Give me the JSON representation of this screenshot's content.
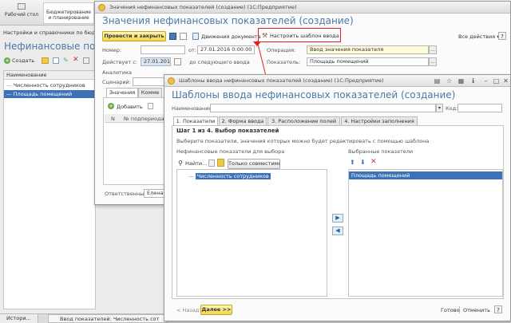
{
  "colors": {
    "accent": "#4a7aa6",
    "highlight_red": "#e02020",
    "selection": "#3e72b8"
  },
  "sections": [
    {
      "label": "Рабочий стол",
      "icon": "desktop-icon"
    },
    {
      "label": "Бюджетирование и планирование",
      "icon": "budget-icon"
    }
  ],
  "nav": {
    "breadcrumb": "Настройки и справочники по бюджет"
  },
  "list_form": {
    "title": "Нефинансовые показа",
    "create_button": "Создать",
    "column_header": "Наименование",
    "items": [
      "Численность сотрудников",
      "Площадь помещений"
    ]
  },
  "statusbar": {
    "tabs": [
      "Истори...",
      "Ввод показателей: Численность сот"
    ]
  },
  "doc_window": {
    "window_title": "Значения нефинансовых показателей (создание)  (1С:Предприятие)",
    "form_title": "Значения нефинансовых показателей (создание)",
    "post_close_button": "Провести и закрыть",
    "movements_button": "Движения документа",
    "setup_template_button": "Настроить шаблон ввода",
    "all_actions": "Все действия ▾",
    "help": "?",
    "number_label": "Номер:",
    "from_label": "от:",
    "date_value": "27.01.2016  0:00:00",
    "operation_label": "Операция:",
    "operation_value": "Ввод значения показателя",
    "effective_label": "Действует с:",
    "effective_value": "27.01.2016",
    "until_label": "до следующего ввода",
    "indicator_label": "Показатель:",
    "indicator_value": "Площадь помещений",
    "analytics_label": "Аналитика",
    "scenario_label": "Сценарий:",
    "tabs": [
      "Значения",
      "Комме"
    ],
    "add_button": "Добавить",
    "table_headers": [
      "N",
      "№ подпериода"
    ],
    "responsible_label": "Ответственный:",
    "responsible_value": "Елена"
  },
  "wizard": {
    "window_title": "Шаблоны ввода нефинансовых показателей (создание)  (1С:Предприятие)",
    "form_title": "Шаблоны ввода нефинансовых показателей (создание)",
    "name_label": "Наименование:",
    "code_label": "Код:",
    "tabs": [
      "1. Показатели",
      "2. Форма ввода",
      "3. Расположение полей",
      "4. Настройки заполнения"
    ],
    "step_title": "Шаг 1 из 4. Выбор показателей",
    "step_description": "Выберите показатели, значения которых можно будет редактировать с помощью шаблона",
    "left_list_label": "Нефинансовые показатели для выбора",
    "right_list_label": "Выбранные показатели",
    "find_button": "Найти...",
    "only_compatible_button": "Только совместимые",
    "left_items": [
      "Численность сотрудников"
    ],
    "right_items": [
      "Площадь помещений"
    ],
    "back_button": "< Назад",
    "next_button": "Далее >>",
    "done_button": "Готово",
    "cancel_button": "Отменить",
    "help": "?"
  }
}
